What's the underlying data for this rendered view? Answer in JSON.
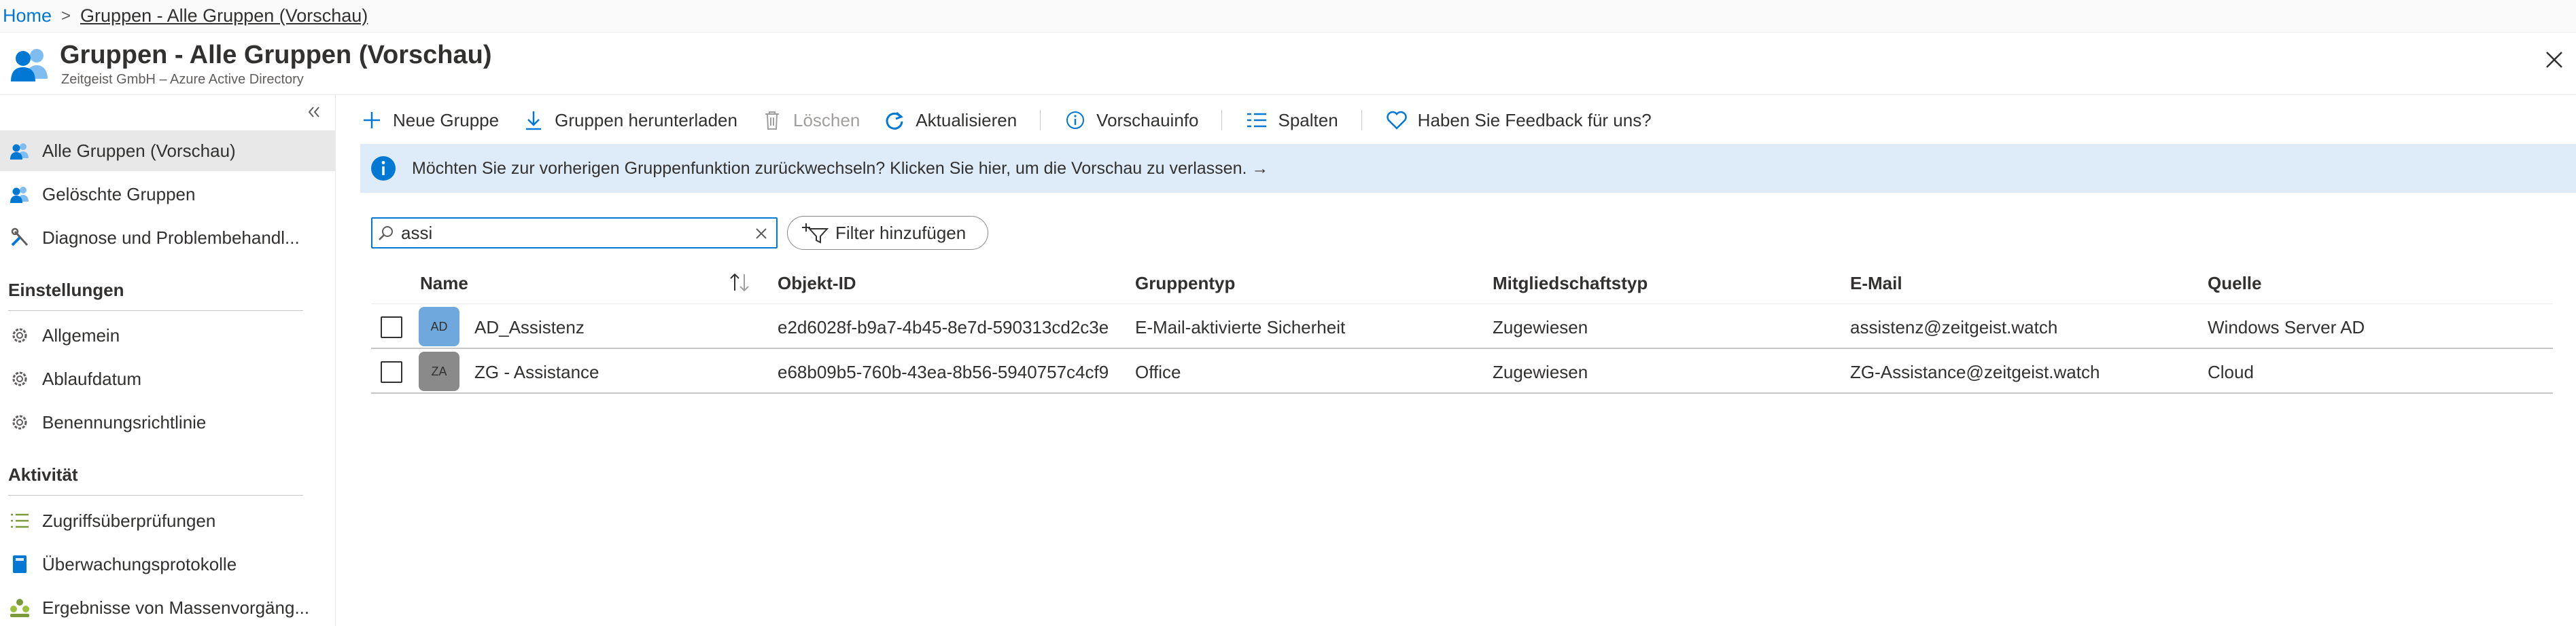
{
  "breadcrumb": {
    "home": "Home",
    "separator": ">",
    "current": "Gruppen - Alle Gruppen (Vorschau)"
  },
  "header": {
    "title": "Gruppen - Alle Gruppen (Vorschau)",
    "subtitle": "Zeitgeist GmbH – Azure Active Directory",
    "icon": "groups-icon",
    "close_icon": "close-icon"
  },
  "sidebar": {
    "collapse_icon": "double-chevron-left-icon",
    "items": [
      {
        "label": "Alle Gruppen (Vorschau)",
        "icon": "groups-icon",
        "active": true
      },
      {
        "label": "Gelöschte Gruppen",
        "icon": "groups-icon",
        "active": false
      },
      {
        "label": "Diagnose und Problembehandl...",
        "icon": "wrench-icon",
        "active": false
      }
    ],
    "section_settings": "Einstellungen",
    "settings_items": [
      {
        "label": "Allgemein",
        "icon": "gear-icon"
      },
      {
        "label": "Ablaufdatum",
        "icon": "gear-icon"
      },
      {
        "label": "Benennungsrichtlinie",
        "icon": "gear-icon"
      }
    ],
    "section_activity": "Aktivität",
    "activity_items": [
      {
        "label": "Zugriffsüberprüfungen",
        "icon": "list-icon"
      },
      {
        "label": "Überwachungsprotokolle",
        "icon": "book-icon"
      },
      {
        "label": "Ergebnisse von Massenvorgäng...",
        "icon": "people-bulk-icon"
      }
    ]
  },
  "toolbar": {
    "new_group": "Neue Gruppe",
    "download": "Gruppen herunterladen",
    "delete": "Löschen",
    "refresh": "Aktualisieren",
    "preview_info": "Vorschauinfo",
    "columns": "Spalten",
    "feedback": "Haben Sie Feedback für uns?"
  },
  "banner": {
    "text": "Möchten Sie zur vorherigen Gruppenfunktion zurückwechseln? Klicken Sie hier, um die Vorschau zu verlassen. →"
  },
  "search": {
    "value": "assi",
    "placeholder": ""
  },
  "filter": {
    "label": "Filter hinzufügen"
  },
  "table": {
    "columns": [
      "Name",
      "Objekt-ID",
      "Gruppentyp",
      "Mitgliedschaftstyp",
      "E-Mail",
      "Quelle"
    ],
    "rows": [
      {
        "avatar": "AD",
        "avatar_color": "#6fa8dc",
        "name": "AD_Assistenz",
        "object_id": "e2d6028f-b9a7-4b45-8e7d-590313cd2c3e",
        "group_type": "E-Mail-aktivierte Sicherheit",
        "membership": "Zugewiesen",
        "email": "assistenz@zeitgeist.watch",
        "source": "Windows Server AD"
      },
      {
        "avatar": "ZA",
        "avatar_color": "#8a8a8a",
        "name": "ZG - Assistance",
        "object_id": "e68b09b5-760b-43ea-8b56-5940757c4cf9",
        "group_type": "Office",
        "membership": "Zugewiesen",
        "email": "ZG-Assistance@zeitgeist.watch",
        "source": "Cloud"
      }
    ]
  },
  "colors": {
    "accent": "#0078d4",
    "banner_bg": "#deecf9",
    "active_nav": "#e8e8e8"
  }
}
